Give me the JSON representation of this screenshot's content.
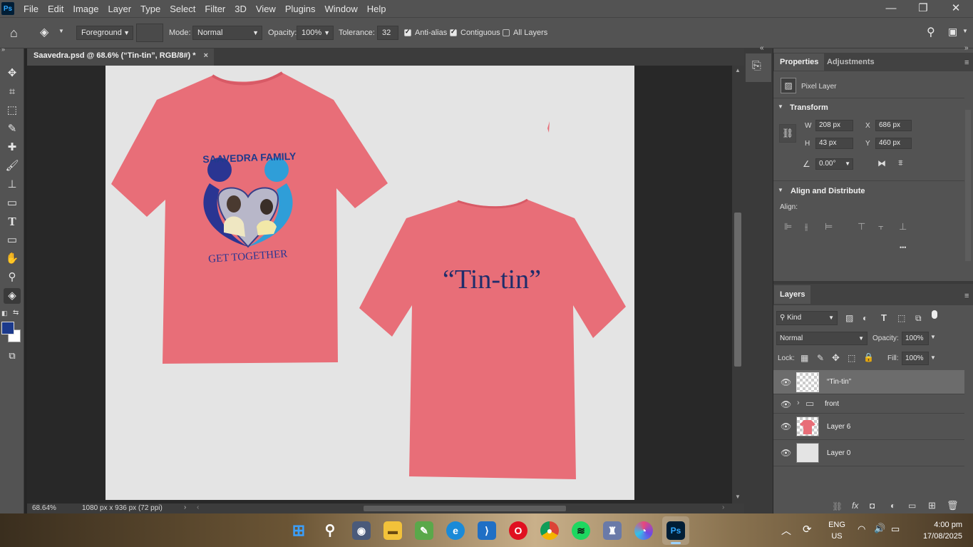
{
  "app": {
    "logo": "Ps"
  },
  "menu": [
    "File",
    "Edit",
    "Image",
    "Layer",
    "Type",
    "Select",
    "Filter",
    "3D",
    "View",
    "Plugins",
    "Window",
    "Help"
  ],
  "window_controls": {
    "minimize": "—",
    "restore": "❐",
    "close": "✕"
  },
  "options": {
    "fill_source": "Foreground",
    "mode_label": "Mode:",
    "mode_value": "Normal",
    "opacity_label": "Opacity:",
    "opacity_value": "100%",
    "tolerance_label": "Tolerance:",
    "tolerance_value": "32",
    "antialias_label": "Anti-alias",
    "antialias_checked": true,
    "contiguous_label": "Contiguous",
    "contiguous_checked": true,
    "alllayers_label": "All Layers",
    "alllayers_checked": false
  },
  "document": {
    "tab_title": "Saavedra.psd @ 68.6% (“Tin-tin”, RGB/8#) *",
    "tab_close": "×",
    "front_shirt_top_text": "SAAVEDRA FAMILY",
    "front_shirt_bottom_text": "GET TOGETHER",
    "back_shirt_text": "“Tin-tin”",
    "shirt_color": "#e86e78",
    "text_color": "#1f2d6b"
  },
  "status": {
    "zoom": "68.64%",
    "dimensions": "1080 px x 936 px (72 ppi)"
  },
  "properties": {
    "tabs": [
      "Properties",
      "Adjustments"
    ],
    "layer_kind": "Pixel Layer",
    "transform_title": "Transform",
    "w_label": "W",
    "w_value": "208 px",
    "h_label": "H",
    "h_value": "43 px",
    "x_label": "X",
    "x_value": "686 px",
    "y_label": "Y",
    "y_value": "460 px",
    "angle_value": "0.00°",
    "align_title": "Align and Distribute",
    "align_label": "Align:",
    "more": "•••"
  },
  "layers": {
    "tab": "Layers",
    "kind_label": "Kind",
    "blend_mode": "Normal",
    "opacity_label": "Opacity:",
    "opacity_value": "100%",
    "lock_label": "Lock:",
    "fill_label": "Fill:",
    "fill_value": "100%",
    "items": [
      {
        "name": "“Tin-tin”",
        "selected": true
      },
      {
        "name": "front",
        "group": true
      },
      {
        "name": "Layer 6"
      },
      {
        "name": "Layer 0"
      }
    ]
  },
  "taskbar": {
    "lang_top": "ENG",
    "lang_bottom": "US",
    "time": "4:00 pm",
    "date": "17/08/2025",
    "ps_label": "Ps"
  }
}
